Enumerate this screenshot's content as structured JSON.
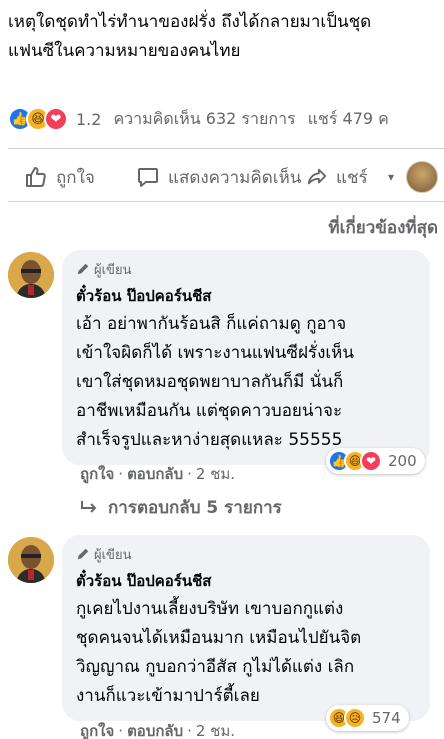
{
  "post": {
    "text_line1": "เหตุใดชุดทำไร่ทำนาของฝรั่ง ถึงได้กลายมาเป็นชุด",
    "text_line2": "แฟนซีในความหมายของคนไทย"
  },
  "stats": {
    "reactions_count": "1.2",
    "comments": "ความคิดเห็น 632 รายการ",
    "shares": "แชร์ 479 ค"
  },
  "actions": {
    "like_label": "ถูกใจ",
    "comment_label": "แสดงความคิดเห็น",
    "share_label": "แชร์"
  },
  "sort_label": "ที่เกี่ยวข้องที่สุด",
  "comments": [
    {
      "badge": "ผู้เขียน",
      "author": "ตั๋วร้อน ป๊อปคอร์นชีส",
      "lines": [
        "เอ้า อย่าพากันร้อนสิ ก็แค่ถามดู กูอาจ",
        "เข้าใจผิดก็ได้ เพราะงานแฟนซีฝรั่งเห็น",
        "เขาใส่ชุดหมอชุดพยาบาลกันก็มี นั่นก็",
        "อาชีพเหมือนกัน แต่ชุดคาวบอยน่าจะ",
        "สำเร็จรูปและหาง่ายสุดแหละ 55555"
      ],
      "like": "ถูกใจ",
      "reply": "ตอบกลับ",
      "time": "2 ชม.",
      "reaction_count": "200",
      "replies_label": "การตอบกลับ 5 รายการ"
    },
    {
      "badge": "ผู้เขียน",
      "author": "ตั๋วร้อน ป๊อปคอร์นชีส",
      "lines": [
        "กูเคยไปงานเลี้ยงบริษัท เขาบอกกูแต่ง",
        "ชุดคนจนได้เหมือนมาก เหมือนไปยันจิต",
        "วิญญาณ กูบอกว่าอีสัส กูไม่ได้แต่ง เลิก",
        "งานก็แวะเข้ามาปาร์ตี้เลย"
      ],
      "like": "ถูกใจ",
      "reply": "ตอบกลับ",
      "time": "2 ชม.",
      "reaction_count": "574"
    }
  ],
  "colors": {
    "like": "#1877f2",
    "haha": "#f7b125",
    "love": "#f33e58",
    "bubble": "#f0f2f5",
    "secondary_text": "#65676b"
  },
  "icons": [
    "like-icon",
    "haha-icon",
    "love-icon",
    "sad-icon",
    "comment-icon",
    "share-icon",
    "pencil-icon",
    "reply-arrow-icon"
  ]
}
